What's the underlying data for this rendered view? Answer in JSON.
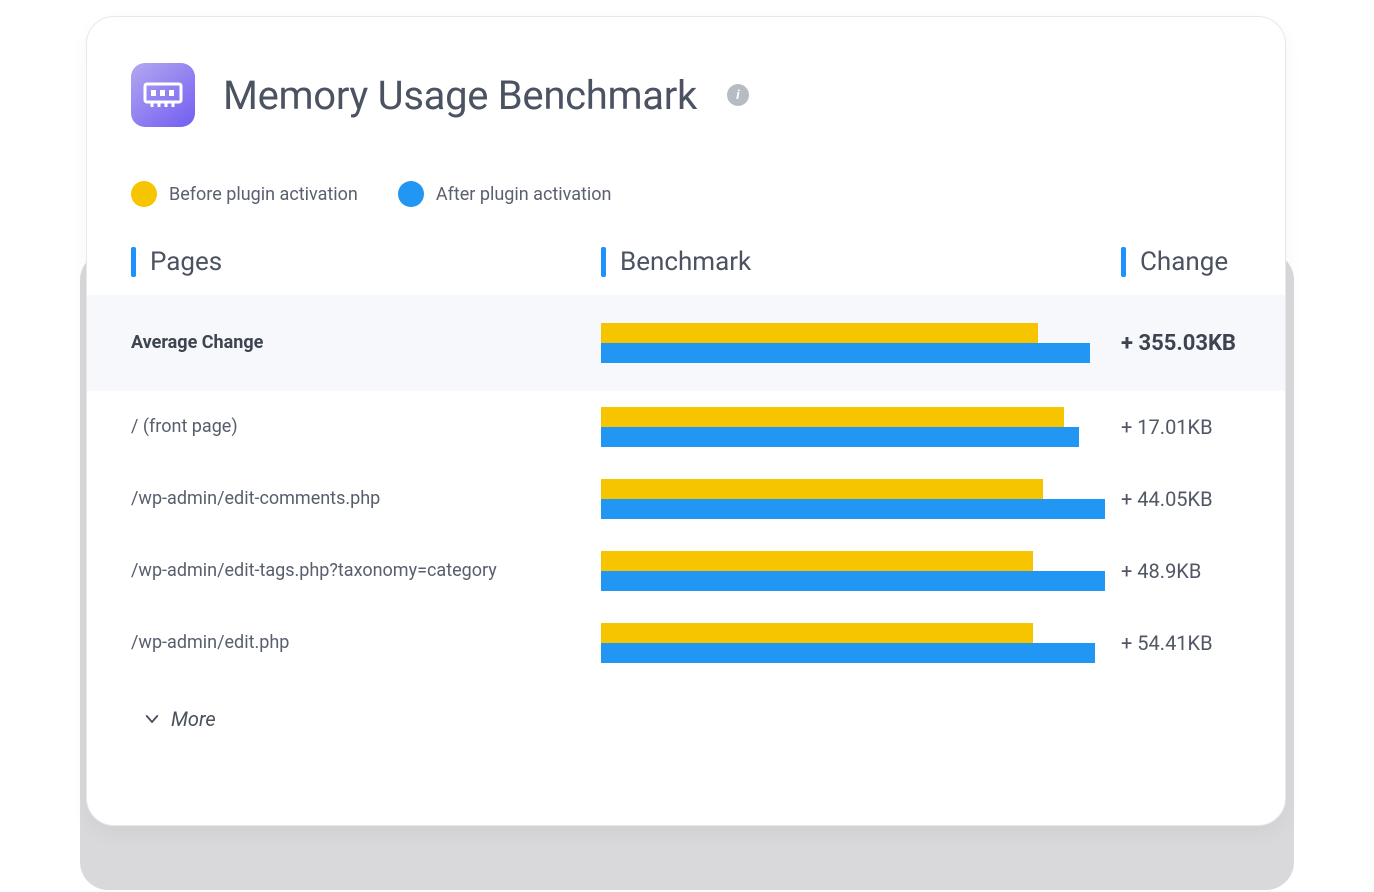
{
  "header": {
    "title": "Memory Usage Benchmark"
  },
  "legend": {
    "before": "Before plugin activation",
    "after": "After plugin activation"
  },
  "columns": {
    "pages": "Pages",
    "benchmark": "Benchmark",
    "change": "Change"
  },
  "colors": {
    "before": "#f7c400",
    "after": "#2196f3"
  },
  "rows": [
    {
      "label": "Average Change",
      "before_pct": 84,
      "after_pct": 94,
      "change": "+ 355.03KB",
      "highlight": true
    },
    {
      "label": "/ (front page)",
      "before_pct": 89,
      "after_pct": 92,
      "change": "+ 17.01KB",
      "highlight": false
    },
    {
      "label": "/wp-admin/edit-comments.php",
      "before_pct": 85,
      "after_pct": 97,
      "change": "+ 44.05KB",
      "highlight": false
    },
    {
      "label": "/wp-admin/edit-tags.php?taxonomy=category",
      "before_pct": 83,
      "after_pct": 97,
      "change": "+ 48.9KB",
      "highlight": false
    },
    {
      "label": "/wp-admin/edit.php",
      "before_pct": 83,
      "after_pct": 95,
      "change": "+ 54.41KB",
      "highlight": false
    }
  ],
  "more_label": "More",
  "chart_data": {
    "type": "bar",
    "title": "Memory Usage Benchmark",
    "categories": [
      "Average Change",
      "/ (front page)",
      "/wp-admin/edit-comments.php",
      "/wp-admin/edit-tags.php?taxonomy=category",
      "/wp-admin/edit.php"
    ],
    "series": [
      {
        "name": "Before plugin activation",
        "values_pct": [
          84,
          89,
          85,
          83,
          83
        ]
      },
      {
        "name": "After plugin activation",
        "values_pct": [
          94,
          92,
          97,
          97,
          95
        ]
      }
    ],
    "change_labels": [
      "+ 355.03KB",
      "+ 17.01KB",
      "+ 44.05KB",
      "+ 48.9KB",
      "+ 54.41KB"
    ],
    "xlabel": "",
    "ylabel": "",
    "ylim": [
      0,
      100
    ]
  }
}
